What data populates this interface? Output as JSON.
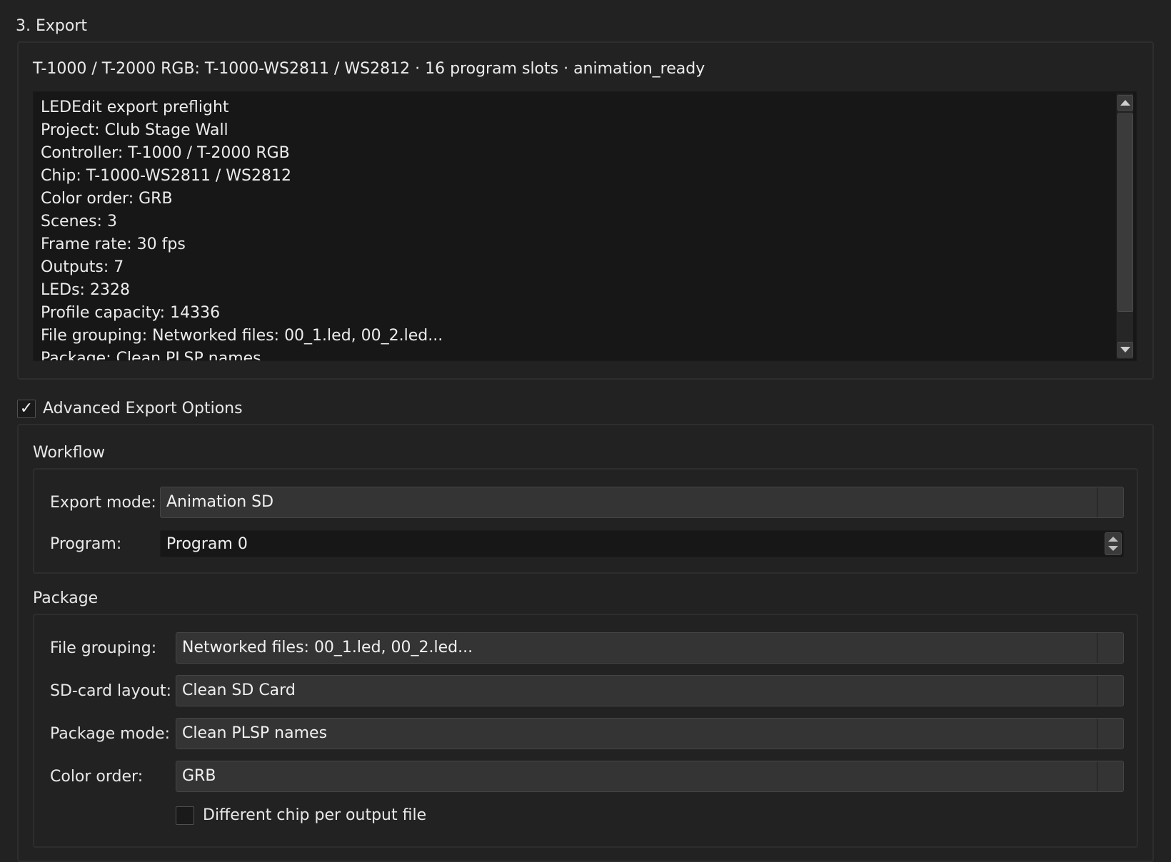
{
  "section": {
    "title": "3. Export"
  },
  "summary": "T-1000 / T-2000 RGB: T-1000-WS2811 / WS2812 · 16 program slots · animation_ready",
  "preflight": {
    "lines": [
      "LEDEdit export preflight",
      "Project: Club Stage Wall",
      "Controller: T-1000 / T-2000 RGB",
      "Chip: T-1000-WS2811 / WS2812",
      "Color order: GRB",
      "Scenes: 3",
      "Frame rate: 30 fps",
      "Outputs: 7",
      "LEDs: 2328",
      "Profile capacity: 14336",
      "File grouping: Networked files: 00_1.led, 00_2.led...",
      "Package: Clean PLSP names"
    ]
  },
  "advanced": {
    "label": "Advanced Export Options",
    "checked": true,
    "check_glyph": "✓"
  },
  "workflow": {
    "title": "Workflow",
    "export_mode": {
      "label": "Export mode:",
      "value": "Animation SD"
    },
    "program": {
      "label": "Program:",
      "value": "Program 0"
    }
  },
  "package": {
    "title": "Package",
    "file_grouping": {
      "label": "File grouping:",
      "value": "Networked files: 00_1.led, 00_2.led..."
    },
    "sd_layout": {
      "label": "SD-card layout:",
      "value": "Clean SD Card"
    },
    "package_mode": {
      "label": "Package mode:",
      "value": "Clean PLSP names"
    },
    "color_order": {
      "label": "Color order:",
      "value": "GRB"
    },
    "diff_chip": {
      "label": "Different chip per output file",
      "checked": false
    }
  }
}
